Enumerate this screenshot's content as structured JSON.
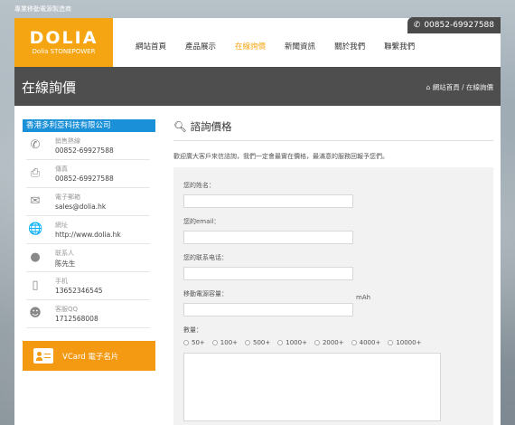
{
  "top_note": "專業移動電源製造商",
  "phone": "00852-69927588",
  "logo": {
    "name": "DOLIA",
    "sub": "Dolia STONEPOWER"
  },
  "nav": [
    "網站首頁",
    "產品展示",
    "在線詢價",
    "新聞資訊",
    "關於我們",
    "聯繫我們"
  ],
  "banner": {
    "title": "在線詢價",
    "breadcrumb": "網站首頁 / 在線詢價"
  },
  "sidebar": {
    "company": "香港多利亞科技有限公司",
    "items": [
      {
        "label": "銷售熱線",
        "value": "00852-69927588",
        "icon": "phone-icon"
      },
      {
        "label": "傳真",
        "value": "00852-69927588",
        "icon": "fax-icon"
      },
      {
        "label": "電子郵箱",
        "value": "sales@dolia.hk",
        "icon": "mail-icon"
      },
      {
        "label": "網址",
        "value": "http://www.dolia.hk",
        "icon": "globe-icon"
      },
      {
        "label": "联系人",
        "value": "陈先生",
        "icon": "user-icon"
      },
      {
        "label": "手机",
        "value": "13652346545",
        "icon": "mobile-icon"
      },
      {
        "label": "客服QQ",
        "value": "1712568008",
        "icon": "qq-icon"
      }
    ],
    "vcard": "VCard 電子名片"
  },
  "content": {
    "title": "諮詢價格",
    "intro": "歡迎廣大客戶來信諮詢，我們一定會最實在價格，最滿意的服務回報予您們。",
    "fields": {
      "name": "您的姓名：",
      "email": "您的email：",
      "tel": "您的联系电话：",
      "capacity": "移動電源容量：",
      "unit": "mAh",
      "qty": "數量："
    },
    "quantities": [
      "50+",
      "100+",
      "500+",
      "1000+",
      "2000+",
      "4000+",
      "10000+"
    ]
  }
}
